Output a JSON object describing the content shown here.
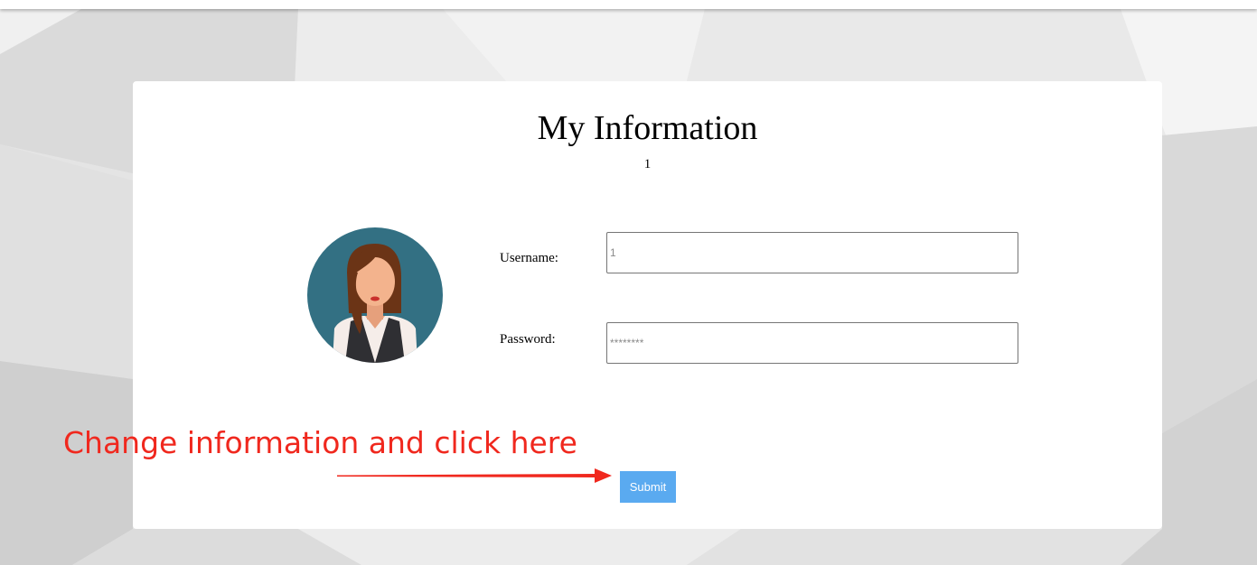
{
  "page": {
    "title": "My Information",
    "user_id": "1"
  },
  "form": {
    "username": {
      "label": "Username:",
      "placeholder": "1"
    },
    "password": {
      "label": "Password:",
      "placeholder": "********"
    },
    "submit_label": "Submit"
  },
  "annotation": {
    "text": "Change information and click here",
    "color": "#f0281e"
  },
  "colors": {
    "submit_button": "#5aaaf0",
    "avatar_background": "#337083"
  },
  "icons": {
    "avatar": "woman-avatar-icon",
    "arrow": "red-arrow-annotation"
  }
}
